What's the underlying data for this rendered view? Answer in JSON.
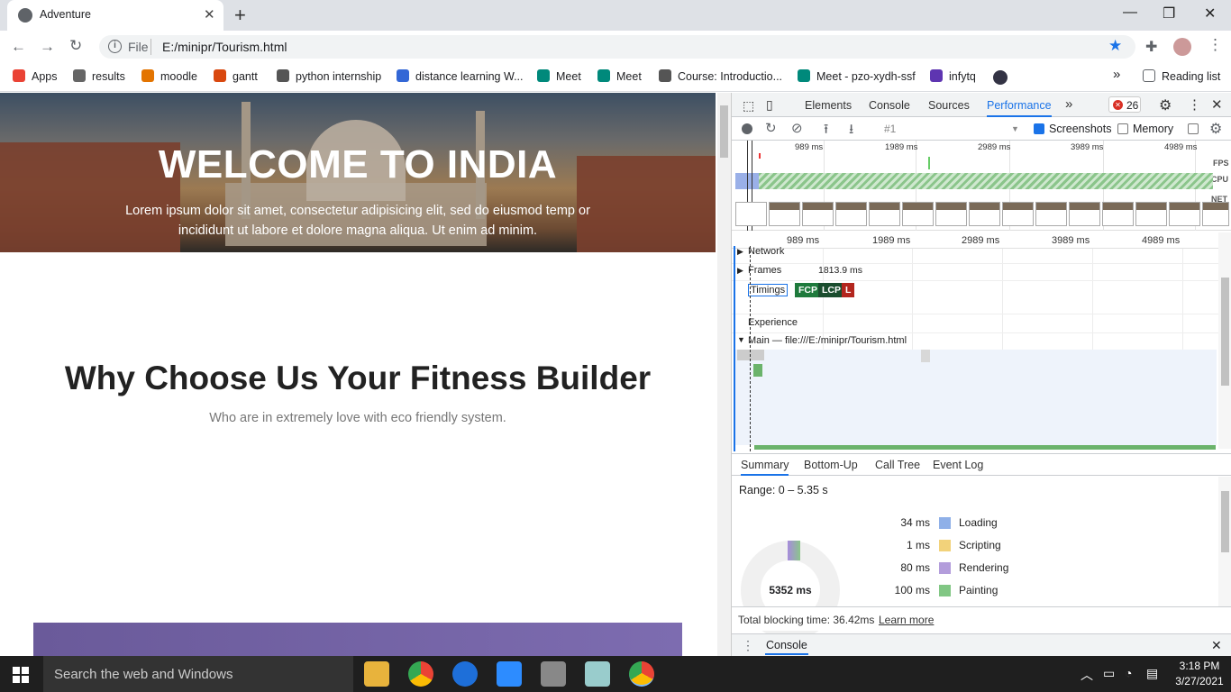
{
  "browser": {
    "tab_title": "Adventure",
    "url_scheme": "File",
    "url": "E:/minipr/Tourism.html",
    "bookmarks": [
      "Apps",
      "results",
      "moodle",
      "gantt",
      "python internship",
      "distance learning W...",
      "Meet",
      "Meet",
      "Course: Introductio...",
      "Meet - pzo-xydh-ssf",
      "infytq"
    ],
    "bookmark_colors": [
      "#ea4335",
      "#666666",
      "#e37400",
      "#d9480f",
      "#555555",
      "#3367d6",
      "#00897b",
      "#00897b",
      "#555555",
      "#00897b",
      "#5e35b1"
    ],
    "overflow": "»",
    "reading_list": "Reading list"
  },
  "page": {
    "hero_title": "WELCOME TO INDIA",
    "hero_subtitle": "Lorem ipsum dolor sit amet, consectetur adipisicing elit, sed do eiusmod temp or incididunt ut labore et dolore magna aliqua. Ut enim ad minim.",
    "section_title": "Why Choose Us Your Fitness Builder",
    "section_subtitle": "Who are in extremely love with eco friendly system."
  },
  "devtools": {
    "tabs": [
      "Elements",
      "Console",
      "Sources",
      "Performance"
    ],
    "active_tab": "Performance",
    "error_count": "26",
    "recording": "#1",
    "screenshots_label": "Screenshots",
    "memory_label": "Memory",
    "overview_ticks": [
      "989 ms",
      "1989 ms",
      "2989 ms",
      "3989 ms",
      "4989 ms"
    ],
    "lane_labels": [
      "FPS",
      "CPU",
      "NET"
    ],
    "ruler_ticks": [
      "989 ms",
      "1989 ms",
      "2989 ms",
      "3989 ms",
      "4989 ms"
    ],
    "tracks": {
      "network": "Network",
      "frames": "Frames",
      "frames_value": "1813.9 ms",
      "timings": "Timings",
      "timing_markers": [
        "FCP",
        "LCP",
        "L"
      ],
      "experience": "Experience",
      "main": "Main — file:///E:/minipr/Tourism.html"
    },
    "summary_tabs": [
      "Summary",
      "Bottom-Up",
      "Call Tree",
      "Event Log"
    ],
    "range": "Range: 0 – 5.35 s",
    "total": "5352 ms",
    "legend": [
      {
        "value": "34 ms",
        "label": "Loading",
        "color": "#8fb0e8"
      },
      {
        "value": "1 ms",
        "label": "Scripting",
        "color": "#f2d27a"
      },
      {
        "value": "80 ms",
        "label": "Rendering",
        "color": "#b39ddb"
      },
      {
        "value": "100 ms",
        "label": "Painting",
        "color": "#81c784"
      }
    ],
    "blocking": "Total blocking time: 36.42ms",
    "learn_more": "Learn more",
    "drawer_tab": "Console"
  },
  "taskbar": {
    "search_placeholder": "Search the web and Windows",
    "time": "3:18 PM",
    "date": "3/27/2021"
  }
}
